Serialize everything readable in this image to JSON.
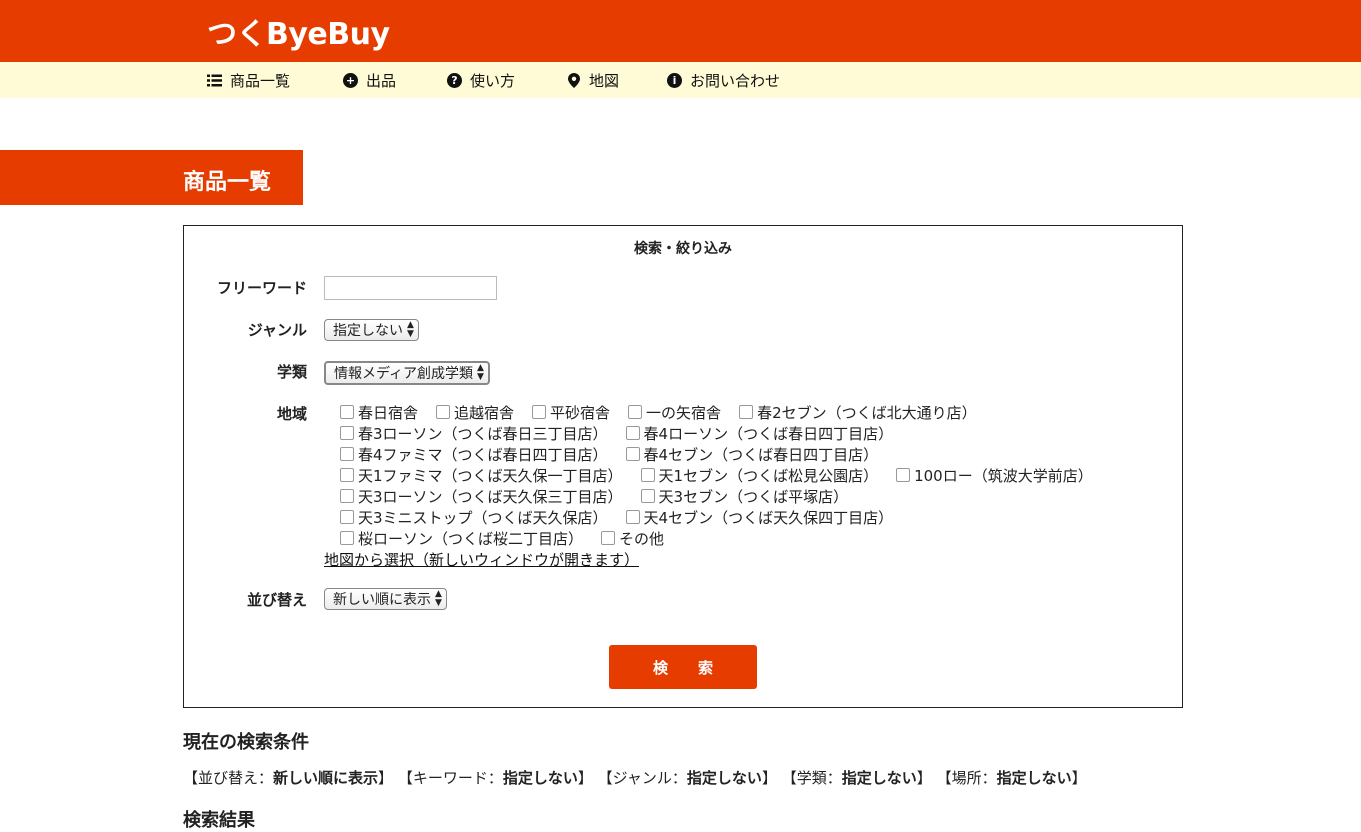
{
  "app": {
    "logo": "つくByeBuy"
  },
  "nav": [
    {
      "icon": "list-icon",
      "label": "商品一覧"
    },
    {
      "icon": "plus-circle-icon",
      "label": "出品"
    },
    {
      "icon": "question-circle-icon",
      "label": "使い方"
    },
    {
      "icon": "map-marker-icon",
      "label": "地図"
    },
    {
      "icon": "info-circle-icon",
      "label": "お問い合わせ"
    }
  ],
  "page": {
    "title": "商品一覧"
  },
  "search": {
    "title": "検索・絞り込み",
    "freeword_label": "フリーワード",
    "freeword_value": "",
    "genre_label": "ジャンル",
    "genre_selected": "指定しない",
    "department_label": "学類",
    "department_selected": "情報メディア創成学類",
    "area_label": "地域",
    "areas": [
      [
        "春日宿舎",
        "追越宿舎",
        "平砂宿舎",
        "一の矢宿舎",
        "春2セブン（つくば北大通り店）"
      ],
      [
        "春3ローソン（つくば春日三丁目店）",
        "春4ローソン（つくば春日四丁目店）"
      ],
      [
        "春4ファミマ（つくば春日四丁目店）",
        "春4セブン（つくば春日四丁目店）"
      ],
      [
        "天1ファミマ（つくば天久保一丁目店）",
        "天1セブン（つくば松見公園店）",
        "100ロー（筑波大学前店）"
      ],
      [
        "天3ローソン（つくば天久保三丁目店）",
        "天3セブン（つくば平塚店）"
      ],
      [
        "天3ミニストップ（つくば天久保店）",
        "天4セブン（つくば天久保四丁目店）"
      ],
      [
        "桜ローソン（つくば桜二丁目店）",
        "その他"
      ]
    ],
    "map_link": "地図から選択（新しいウィンドウが開きます）",
    "sort_label": "並び替え",
    "sort_selected": "新しい順に表示",
    "button": "検索"
  },
  "conditions": {
    "heading": "現在の検索条件",
    "items": [
      {
        "key": "【並び替え：",
        "value": "新しい順に表示",
        "close": "】"
      },
      {
        "key": "【キーワード：",
        "value": "指定しない",
        "close": "】"
      },
      {
        "key": "【ジャンル：",
        "value": "指定しない",
        "close": "】"
      },
      {
        "key": "【学類：",
        "value": "指定しない",
        "close": "】"
      },
      {
        "key": "【場所：",
        "value": "指定しない",
        "close": "】"
      }
    ]
  },
  "results": {
    "heading": "検索結果"
  },
  "colors": {
    "brand": "#e63c00",
    "nav_bg": "#fffbd6"
  }
}
